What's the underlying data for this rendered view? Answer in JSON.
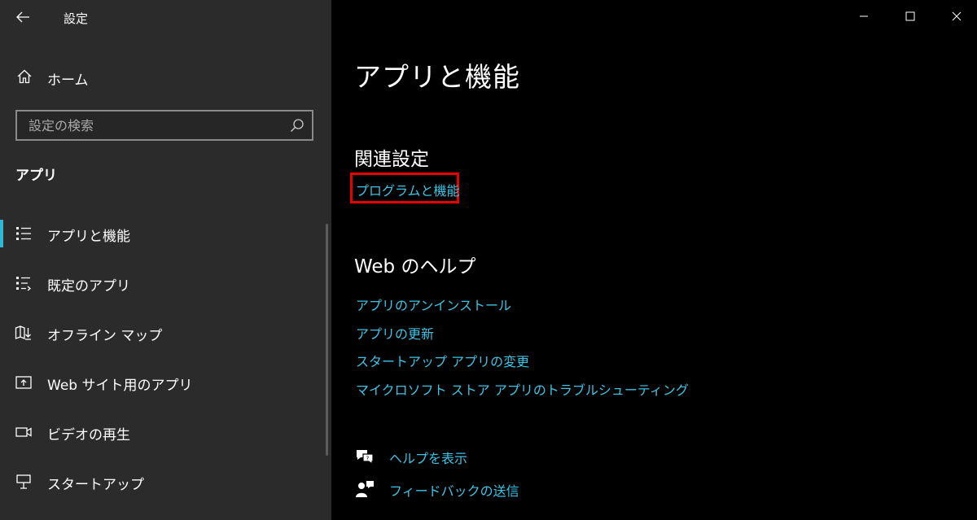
{
  "window": {
    "title": "設定",
    "controls": [
      "minimize",
      "maximize",
      "close"
    ]
  },
  "sidebar": {
    "home_label": "ホーム",
    "search": {
      "placeholder": "設定の検索",
      "value": ""
    },
    "section_title": "アプリ",
    "items": [
      {
        "label": "アプリと機能",
        "icon": "apps-features-icon",
        "selected": true
      },
      {
        "label": "既定のアプリ",
        "icon": "default-apps-icon",
        "selected": false
      },
      {
        "label": "オフライン マップ",
        "icon": "offline-maps-icon",
        "selected": false
      },
      {
        "label": "Web サイト用のアプリ",
        "icon": "apps-for-websites-icon",
        "selected": false
      },
      {
        "label": "ビデオの再生",
        "icon": "video-playback-icon",
        "selected": false
      },
      {
        "label": "スタートアップ",
        "icon": "startup-icon",
        "selected": false
      }
    ]
  },
  "main": {
    "page_title": "アプリと機能",
    "related": {
      "heading": "関連設定",
      "links": [
        "プログラムと機能"
      ]
    },
    "web_help": {
      "heading": "Web のヘルプ",
      "links": [
        "アプリのアンインストール",
        "アプリの更新",
        "スタートアップ アプリの変更",
        "マイクロソフト ストア アプリのトラブルシューティング"
      ]
    },
    "actions": [
      {
        "label": "ヘルプを表示",
        "icon": "get-help-icon"
      },
      {
        "label": "フィードバックの送信",
        "icon": "feedback-icon"
      }
    ]
  },
  "colors": {
    "sidebar_bg": "#2b2b2b",
    "main_bg": "#000000",
    "link": "#3cc5e6",
    "accent_indicator": "#2fb6d4",
    "highlight_border": "#e60000"
  }
}
